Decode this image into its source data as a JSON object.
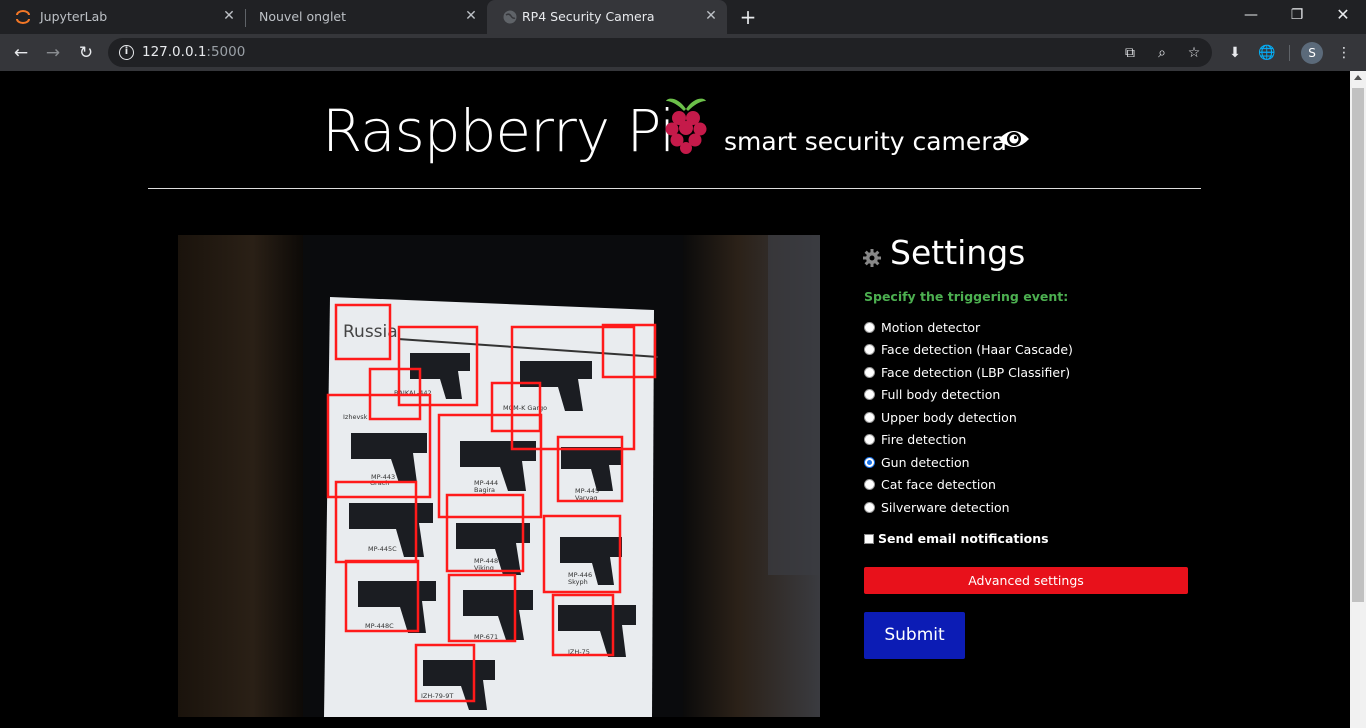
{
  "browser": {
    "tabs": [
      {
        "title": "JupyterLab"
      },
      {
        "title": "Nouvel onglet"
      },
      {
        "title": "RP4 Security Camera"
      }
    ],
    "url_host": "127.0.0.1",
    "url_port": ":5000",
    "profile_initial": "S"
  },
  "header": {
    "title": "Raspberry Pi",
    "subtitle": "smart security camera"
  },
  "camera": {
    "poster_heading": "Russia",
    "gun_labels": [
      "BAIKAL-442",
      "MCM-K Gargo",
      "Izhevsk",
      "MP-443",
      "MP-444",
      "MP-445",
      "MP-445C",
      "MP-448",
      "MP-446",
      "MP-448C",
      "MP-671",
      "IZH-75",
      "IZH-79-9T",
      "Grach",
      "Bagira",
      "Varyag",
      "Viking",
      "Skyph"
    ]
  },
  "settings": {
    "title": "Settings",
    "specify_label": "Specify the triggering event:",
    "options": [
      {
        "label": "Motion detector",
        "checked": false
      },
      {
        "label": "Face detection (Haar Cascade)",
        "checked": false
      },
      {
        "label": "Face detection (LBP Classifier)",
        "checked": false
      },
      {
        "label": "Full body detection",
        "checked": false
      },
      {
        "label": "Upper body detection",
        "checked": false
      },
      {
        "label": "Fire detection",
        "checked": false
      },
      {
        "label": "Gun detection",
        "checked": true
      },
      {
        "label": "Cat face detection",
        "checked": false
      },
      {
        "label": "Silverware detection",
        "checked": false
      }
    ],
    "email_label": "Send email notifications",
    "email_checked": false,
    "advanced_label": "Advanced settings",
    "submit_label": "Submit"
  },
  "colors": {
    "advanced_button": "#e8111b",
    "submit_button": "#0c1cb5",
    "specify_text": "#4caf50",
    "detection_box": "#ff1a1a"
  },
  "icons": [
    "jupyter-icon",
    "globe-icon",
    "close-icon",
    "plus-icon",
    "minimize-icon",
    "restore-icon",
    "back-icon",
    "forward-icon",
    "reload-icon",
    "info-icon",
    "translate-icon",
    "zoom-icon",
    "star-icon",
    "download-icon",
    "extension-globe-icon",
    "raspberry-icon",
    "eye-icon",
    "gear-icon"
  ]
}
